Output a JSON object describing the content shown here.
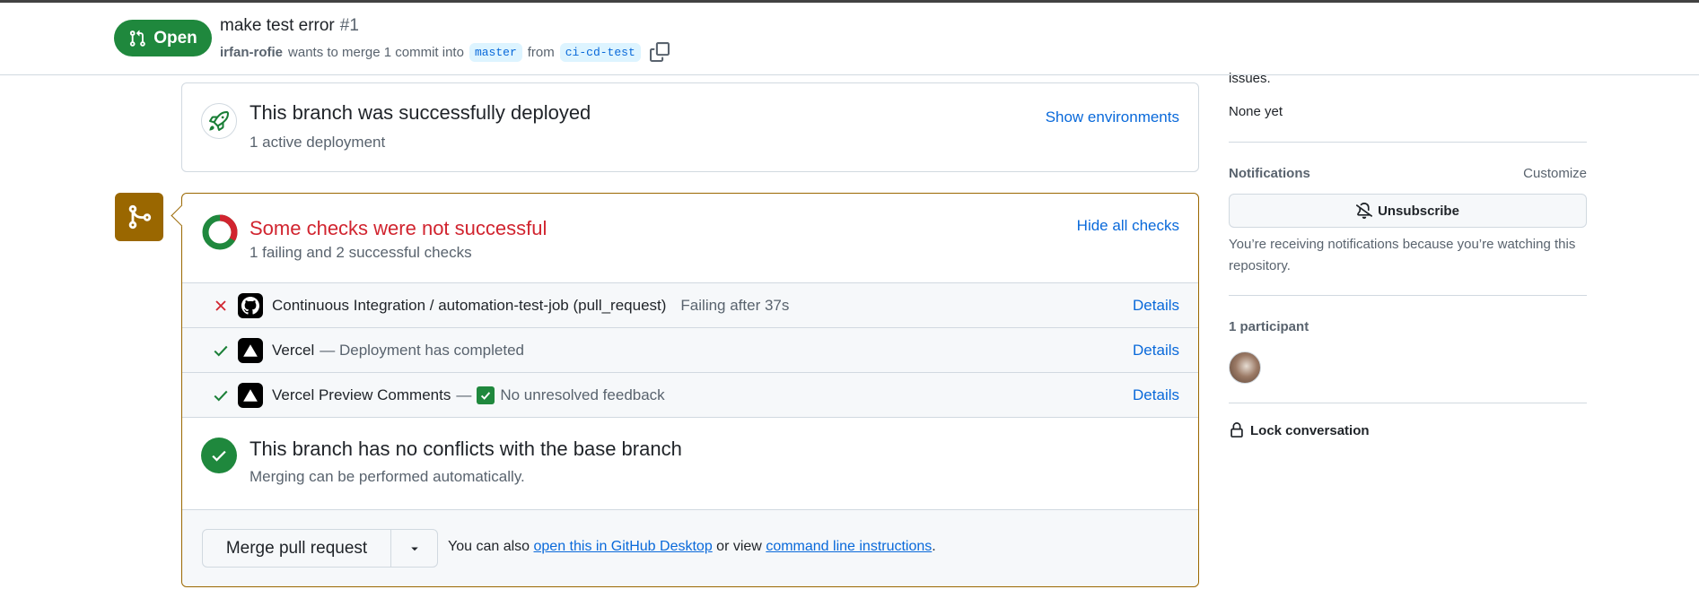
{
  "header": {
    "state": "Open",
    "title": "make test error",
    "number": "#1",
    "author": "irfan-rofie",
    "merge_text": "wants to merge 1 commit into",
    "base_branch": "master",
    "from_text": "from",
    "head_branch": "ci-cd-test"
  },
  "deployment": {
    "title": "This branch was successfully deployed",
    "subtitle": "1 active deployment",
    "link": "Show environments"
  },
  "checks": {
    "title": "Some checks were not successful",
    "subtitle": "1 failing and 2 successful checks",
    "link": "Hide all checks",
    "items": [
      {
        "status": "failure",
        "name": "Continuous Integration / automation-test-job (pull_request)",
        "description": "Failing after 37s",
        "details": "Details",
        "app_icon": "github-icon"
      },
      {
        "status": "success",
        "name": "Vercel",
        "description": "— Deployment has completed",
        "details": "Details",
        "app_icon": "vercel-icon"
      },
      {
        "status": "success",
        "name": "Vercel Preview Comments",
        "separator": "—",
        "description": "No unresolved feedback",
        "details": "Details",
        "app_icon": "vercel-icon"
      }
    ]
  },
  "conflicts": {
    "title": "This branch has no conflicts with the base branch",
    "subtitle": "Merging can be performed automatically."
  },
  "merge": {
    "button": "Merge pull request",
    "note_prefix": "You can also",
    "desktop_link": "open this in GitHub Desktop",
    "note_middle": "or view",
    "cli_link": "command line instructions",
    "note_suffix": "."
  },
  "sidebar": {
    "issues_tail": "issues.",
    "issues_value": "None yet",
    "notifications_heading": "Notifications",
    "customize": "Customize",
    "unsubscribe": "Unsubscribe",
    "notifications_note": "You’re receiving notifications because you’re watching this repository.",
    "participants_heading": "1 participant",
    "lock": "Lock conversation"
  },
  "colors": {
    "open_green": "#1f883d",
    "attention": "#9a6700",
    "danger": "#d1242f",
    "link": "#0969da"
  }
}
